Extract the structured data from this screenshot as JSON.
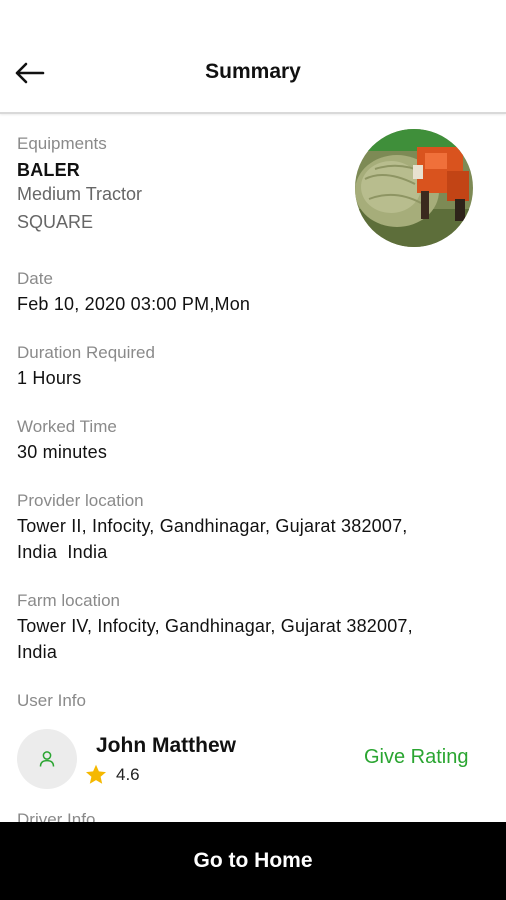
{
  "header": {
    "title": "Summary"
  },
  "equipment": {
    "label": "Equipments",
    "name": "BALER",
    "type": "Medium Tractor",
    "shape": "SQUARE"
  },
  "date": {
    "label": "Date",
    "value": "Feb 10, 2020 03:00 PM,Mon"
  },
  "duration": {
    "label": "Duration Required",
    "value": "1 Hours"
  },
  "worked": {
    "label": "Worked Time",
    "value": "30 minutes"
  },
  "provider_location": {
    "label": "Provider location",
    "line1": "Tower II, Infocity, Gandhinagar, Gujarat 382007,",
    "line2": "India  India"
  },
  "farm_location": {
    "label": "Farm location",
    "line1": "Tower IV, Infocity, Gandhinagar, Gujarat 382007,",
    "line2": "India"
  },
  "user_info": {
    "label": "User Info",
    "name": "John Matthew",
    "rating": "4.6",
    "give_rating": "Give Rating"
  },
  "driver_info": {
    "label": "Driver Info"
  },
  "footer": {
    "button": "Go to Home"
  },
  "colors": {
    "accent_green": "#2aa531",
    "star": "#f5b800",
    "bottom_bar": "#000000"
  },
  "icons": {
    "back": "arrow-left-icon",
    "avatar": "user-icon",
    "star": "star-icon"
  }
}
